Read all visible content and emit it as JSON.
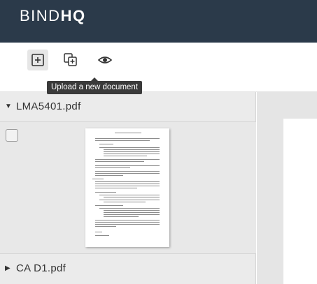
{
  "header": {
    "logo_light": "BIND",
    "logo_bold": "HQ"
  },
  "toolbar": {
    "upload_icon": "plus-square-icon",
    "merge_icon": "copy-merge-icon",
    "preview_icon": "eye-icon",
    "tooltip": "Upload a new document"
  },
  "documents": [
    {
      "name": "LMA5401.pdf",
      "expanded": true,
      "arrow": "▼"
    },
    {
      "name": "CA D1.pdf",
      "expanded": false,
      "arrow": "▶"
    }
  ],
  "colors": {
    "topbar": "#2b3a4a",
    "panel": "#ebebeb",
    "tooltip": "#3a3a3a"
  }
}
